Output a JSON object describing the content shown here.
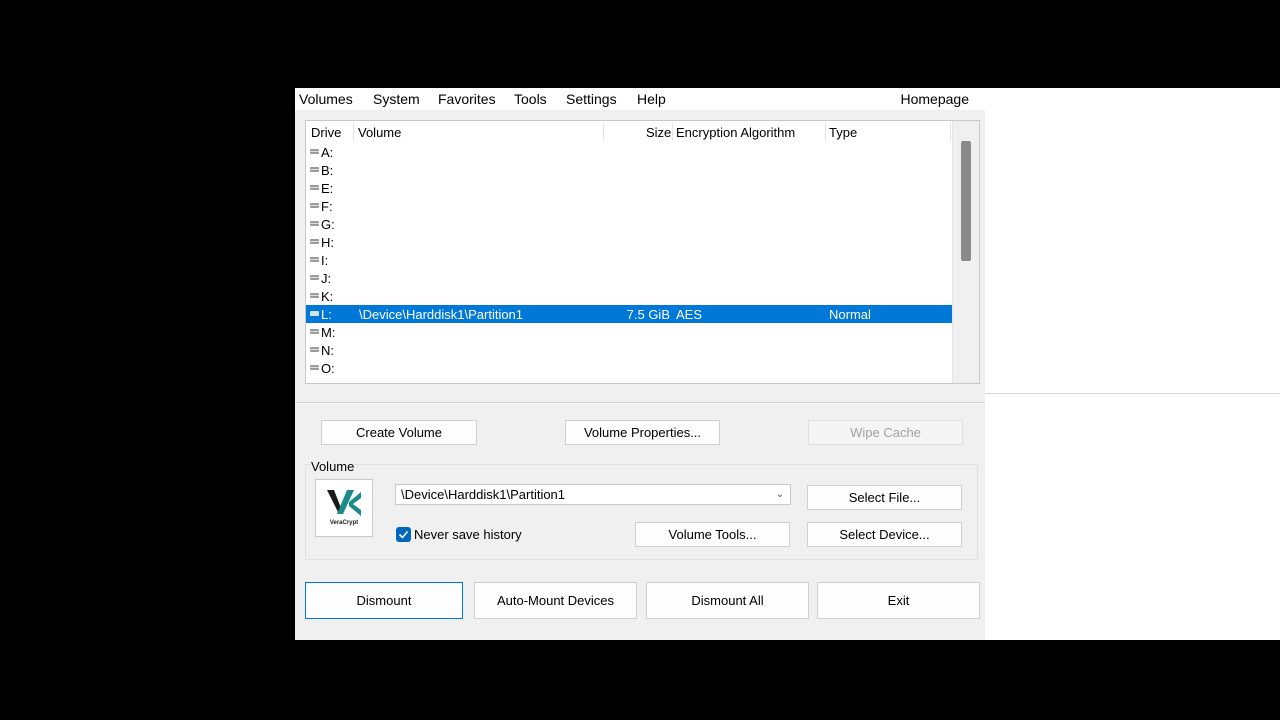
{
  "menu": {
    "items": [
      "Volumes",
      "System",
      "Favorites",
      "Tools",
      "Settings",
      "Help"
    ],
    "homepage": "Homepage"
  },
  "list": {
    "headers": {
      "drive": "Drive",
      "volume": "Volume",
      "size": "Size",
      "encryption": "Encryption Algorithm",
      "type": "Type"
    },
    "rows": [
      {
        "drive": "A:",
        "volume": "",
        "size": "",
        "encryption": "",
        "type": ""
      },
      {
        "drive": "B:",
        "volume": "",
        "size": "",
        "encryption": "",
        "type": ""
      },
      {
        "drive": "E:",
        "volume": "",
        "size": "",
        "encryption": "",
        "type": ""
      },
      {
        "drive": "F:",
        "volume": "",
        "size": "",
        "encryption": "",
        "type": ""
      },
      {
        "drive": "G:",
        "volume": "",
        "size": "",
        "encryption": "",
        "type": ""
      },
      {
        "drive": "H:",
        "volume": "",
        "size": "",
        "encryption": "",
        "type": ""
      },
      {
        "drive": "I:",
        "volume": "",
        "size": "",
        "encryption": "",
        "type": ""
      },
      {
        "drive": "J:",
        "volume": "",
        "size": "",
        "encryption": "",
        "type": ""
      },
      {
        "drive": "K:",
        "volume": "",
        "size": "",
        "encryption": "",
        "type": ""
      },
      {
        "drive": "L:",
        "volume": "\\Device\\Harddisk1\\Partition1",
        "size": "7.5 GiB",
        "encryption": "AES",
        "type": "Normal",
        "selected": true
      },
      {
        "drive": "M:",
        "volume": "",
        "size": "",
        "encryption": "",
        "type": ""
      },
      {
        "drive": "N:",
        "volume": "",
        "size": "",
        "encryption": "",
        "type": ""
      },
      {
        "drive": "O:",
        "volume": "",
        "size": "",
        "encryption": "",
        "type": ""
      }
    ]
  },
  "actions": {
    "create_volume": "Create Volume",
    "volume_properties": "Volume Properties...",
    "wipe_cache": "Wipe Cache"
  },
  "volume_group": {
    "label": "Volume",
    "logo_text": "VeraCrypt",
    "path": "\\Device\\Harddisk1\\Partition1",
    "select_file": "Select File...",
    "select_device": "Select Device...",
    "volume_tools": "Volume Tools...",
    "never_save_history": "Never save history",
    "never_save_history_checked": true
  },
  "bottom": {
    "dismount": "Dismount",
    "auto_mount": "Auto-Mount Devices",
    "dismount_all": "Dismount All",
    "exit": "Exit"
  },
  "colors": {
    "selection": "#0078d7",
    "checkbox": "#0067c0",
    "logo_teal": "#1a8a8a"
  }
}
